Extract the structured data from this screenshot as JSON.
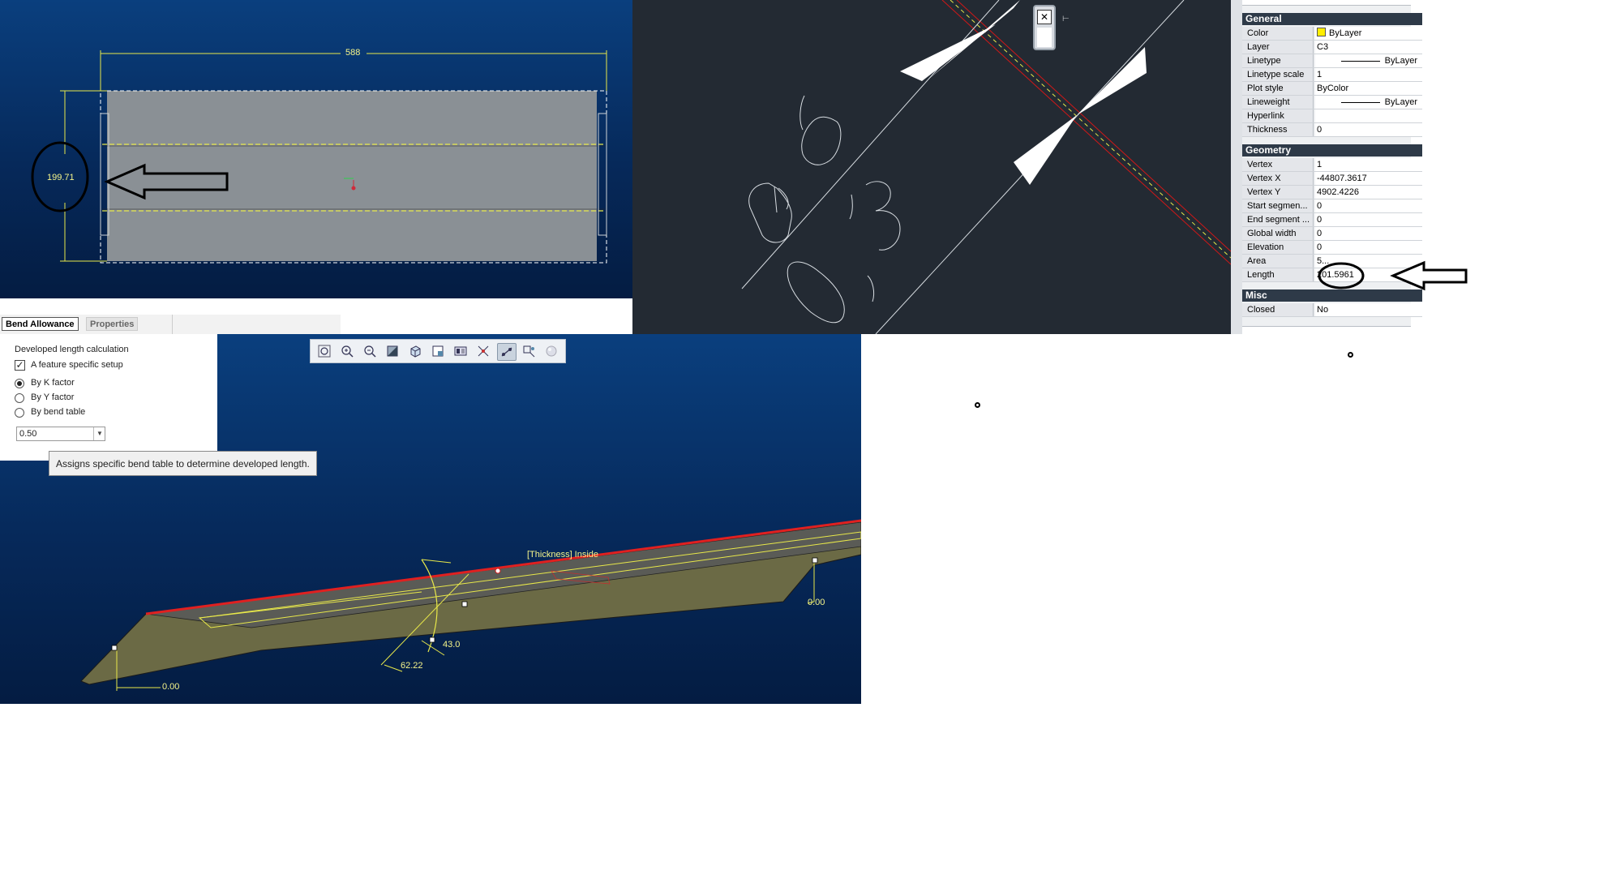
{
  "top_left_viewport": {
    "dim_width": "588",
    "dim_height": "199.71"
  },
  "properties": {
    "sections": {
      "general": "General",
      "geometry": "Geometry",
      "misc": "Misc"
    },
    "general": [
      {
        "key": "Color",
        "value": "ByLayer"
      },
      {
        "key": "Layer",
        "value": "C3"
      },
      {
        "key": "Linetype",
        "value": "ByLayer"
      },
      {
        "key": "Linetype scale",
        "value": "1"
      },
      {
        "key": "Plot style",
        "value": "ByColor"
      },
      {
        "key": "Lineweight",
        "value": "ByLayer"
      },
      {
        "key": "Hyperlink",
        "value": ""
      },
      {
        "key": "Thickness",
        "value": "0"
      }
    ],
    "geometry": [
      {
        "key": "Vertex",
        "value": "1"
      },
      {
        "key": "Vertex X",
        "value": "-44807.3617"
      },
      {
        "key": "Vertex Y",
        "value": "4902.4226"
      },
      {
        "key": "Start segmen...",
        "value": "0"
      },
      {
        "key": "End segment ...",
        "value": "0"
      },
      {
        "key": "Global width",
        "value": "0"
      },
      {
        "key": "Elevation",
        "value": "0"
      },
      {
        "key": "Area",
        "value": "5..."
      },
      {
        "key": "Length",
        "value": "201.5961"
      }
    ],
    "misc": [
      {
        "key": "Closed",
        "value": "No"
      }
    ]
  },
  "tabs": {
    "bend_allowance": "Bend Allowance",
    "properties": "Properties"
  },
  "panel": {
    "heading": "Developed length calculation",
    "checkbox_label": "A feature specific setup",
    "checkbox_checked": true,
    "radio_k": "By K factor",
    "radio_y": "By Y factor",
    "radio_table": "By bend table",
    "selected_radio": "By K factor",
    "factor_value": "0.50"
  },
  "tooltip": "Assigns specific bend table to determine developed length.",
  "model_labels": {
    "thickness": "[Thickness] Inside",
    "angle": "43.0",
    "radius": "62.22",
    "left_zero": "0.00",
    "right_zero": "0.00"
  },
  "colors": {
    "viewport_blue": "#0a3f7e",
    "cad_background": "#232a33",
    "sheet_grey": "#8a9095",
    "dimension_yellow": "#e8e84a",
    "highlight_red": "#e02020",
    "property_header": "#2e3a48"
  }
}
